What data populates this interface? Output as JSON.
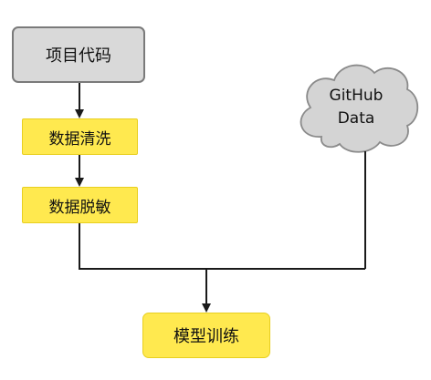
{
  "nodes": {
    "source_code": "项目代码",
    "data_cleaning": "数据清洗",
    "data_desensitization": "数据脱敏",
    "model_training": "模型训练"
  },
  "cloud": {
    "line1": "GitHub",
    "line2": "Data"
  },
  "colors": {
    "source_fill": "#d9d9d9",
    "source_border": "#7a7a7a",
    "step_fill": "#ffe94f",
    "step_border": "#e8cf1f",
    "cloud_fill": "#d4d4d4",
    "cloud_border": "#8a8a8a",
    "line": "#1a1a1a"
  }
}
